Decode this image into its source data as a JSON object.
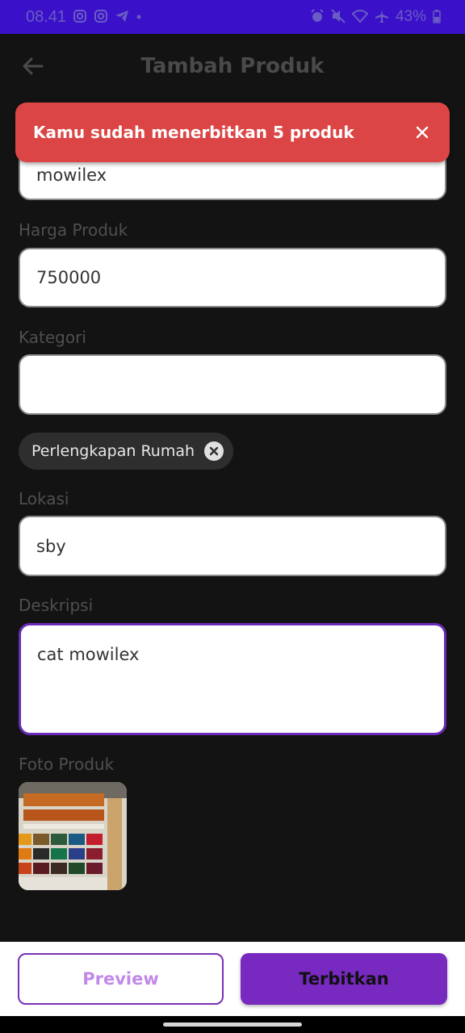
{
  "status_bar": {
    "time": "08.41",
    "battery": "43%",
    "left_icons": [
      "instagram-icon",
      "instagram-icon",
      "telegram-icon",
      "dot-icon"
    ],
    "right_icons": [
      "alarm-icon",
      "mute-icon",
      "wifi-icon",
      "airplane-icon"
    ]
  },
  "app_bar": {
    "title": "Tambah Produk"
  },
  "toast": {
    "message": "Kamu sudah menerbitkan 5 produk",
    "color": "#dc4545"
  },
  "form": {
    "name_value": "mowilex",
    "price_label": "Harga Produk",
    "price_value": "750000",
    "category_label": "Kategori",
    "category_value": "",
    "category_chip": "Perlengkapan Rumah",
    "location_label": "Lokasi",
    "location_value": "sby",
    "description_label": "Deskripsi",
    "description_value": "cat mowilex",
    "photo_label": "Foto Produk"
  },
  "actions": {
    "preview_label": "Preview",
    "publish_label": "Terbitkan",
    "accent": "#7729c0"
  }
}
